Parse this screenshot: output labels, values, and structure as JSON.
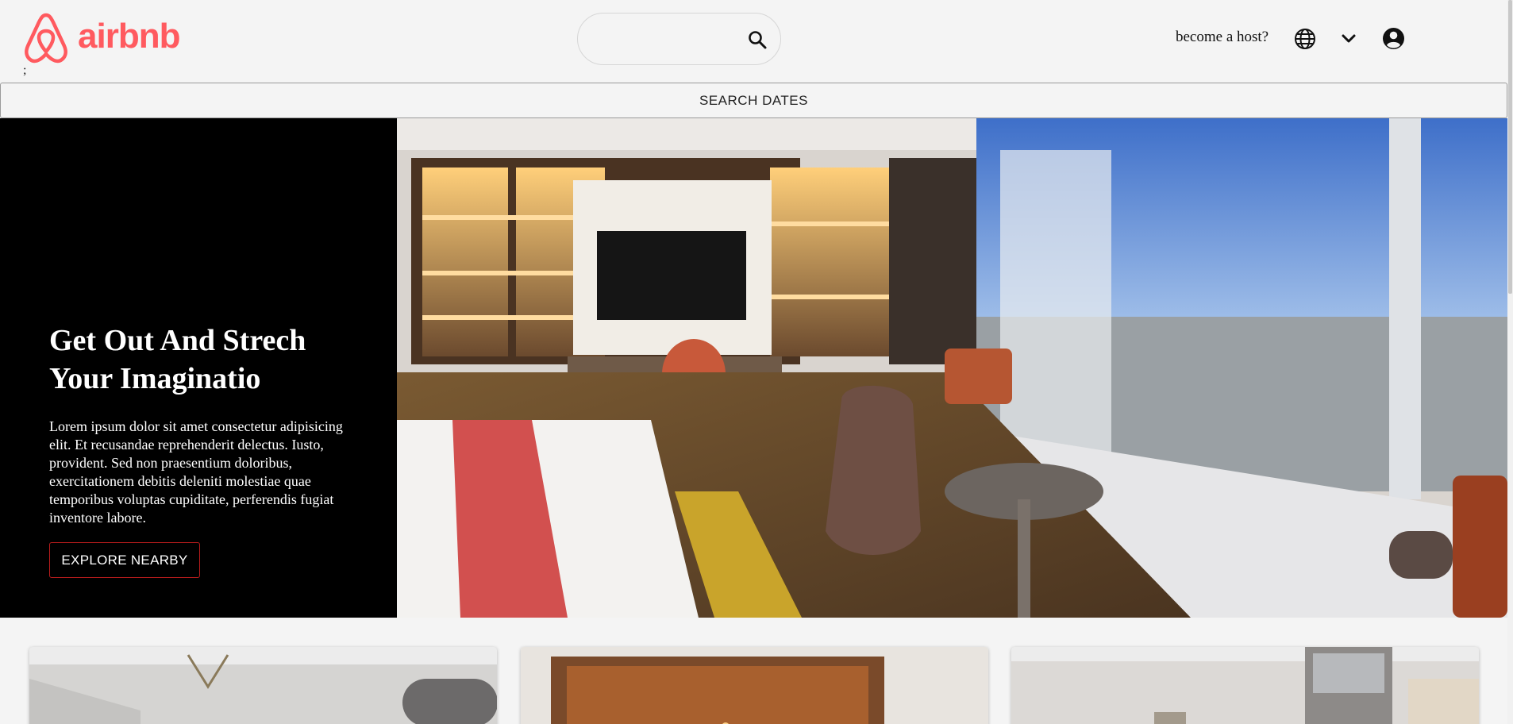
{
  "header": {
    "brand": "airbnb",
    "stray_text": ";",
    "search": {
      "placeholder": "",
      "value": ""
    },
    "host_link": "become a host?",
    "icons": [
      "airbnb-logo-icon",
      "search-icon",
      "globe-icon",
      "chevron-down-icon",
      "account-circle-icon"
    ]
  },
  "search_dates": {
    "label": "SEARCH DATES"
  },
  "hero": {
    "title": "Get Out And Strech Your Imaginatio",
    "text": "Lorem ipsum dolor sit amet consectetur adipisicing elit. Et recusandae reprehenderit delectus. Iusto, provident. Sed non praesentium doloribus, exercitationem debitis deleniti molestiae quae temporibus voluptas cupiditate, perferendis fugiat inventore labore.",
    "button_label": "EXPLORE NEARBY"
  },
  "colors": {
    "brand": "#ff5a5f",
    "hero_panel": "#000000",
    "page_bg": "#f4f4f4",
    "button_border": "#b71c1c"
  }
}
